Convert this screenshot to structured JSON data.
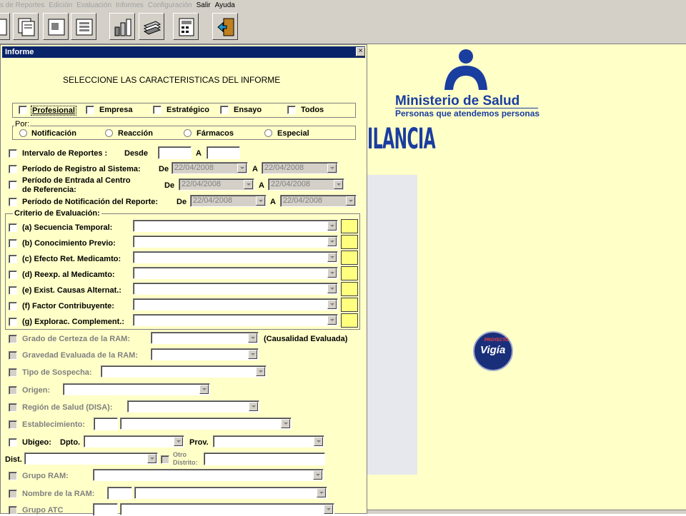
{
  "menu": [
    "s de Reportes",
    "Edición",
    "Evaluación",
    "Informes",
    "Configuración",
    "Salir",
    "Ayuda"
  ],
  "dialog": {
    "title": "Informe",
    "close": "×",
    "heading": "SELECCIONE LAS CARACTERISTICAS DEL INFORME",
    "type_options": [
      "Profesional",
      "Empresa",
      "Estratégico",
      "Ensayo",
      "Todos"
    ],
    "por_label": "Por:",
    "por_options": [
      "Notificación",
      "Reacción",
      "Fármacos",
      "Especial"
    ],
    "intervalo": {
      "label": "Intervalo de Reportes :",
      "desde": "Desde",
      "a": "A"
    },
    "registro": {
      "label": "Período de Registro al Sistema:",
      "de": "De",
      "a": "A",
      "from": "22/04/2008",
      "to": "22/04/2008"
    },
    "entrada": {
      "label1": "Período de Entrada al Centro",
      "label2": "de Referencia:",
      "de": "De",
      "a": "A",
      "from": "22/04/2008",
      "to": "22/04/2008"
    },
    "notificacion": {
      "label": "Período de Notificación del Reporte:",
      "de": "De",
      "a": "A",
      "from": "22/04/2008",
      "to": "22/04/2008"
    },
    "criterio_label": "Criterio de Evaluación:",
    "criterios": [
      "(a) Secuencia Temporal:",
      "(b) Conocimiento Previo:",
      "(c) Efecto Ret. Medicamto:",
      "(d) Reexp. al Medicamto:",
      "(e) Exist. Causas Alternat.:",
      "(f) Factor Contribuyente:",
      "(g) Explorac. Complement.:"
    ],
    "grado": "Grado de Certeza de la RAM:",
    "causalidad": "(Causalidad Evaluada)",
    "gravedad": "Gravedad Evaluada de la RAM:",
    "sospecha": "Tipo de Sospecha:",
    "origen": "Origen:",
    "region": "Región de Salud (DISA):",
    "establecimiento": "Establecimiento:",
    "ubigeo": "Ubigeo:",
    "dpto": "Dpto.",
    "prov": "Prov.",
    "dist": "Dist.",
    "otro_distrito1": "Otro",
    "otro_distrito2": "Distrito:",
    "grupo_ram": "Grupo RAM:",
    "nombre_ram": "Nombre de la  RAM:",
    "partial_row": "Grupo ATC"
  },
  "brand": {
    "name": "Ministerio de Salud",
    "tagline": "Personas que atendemos personas",
    "vigilancia": "ILANCIA",
    "badge_top": "PROYECTO",
    "badge_main": "Vigía"
  },
  "colors": {
    "dialog_bg": "#ffffc8",
    "title_bg": "#0a246a",
    "brand_blue": "#1a3da0",
    "highlight": "#ffff80"
  }
}
